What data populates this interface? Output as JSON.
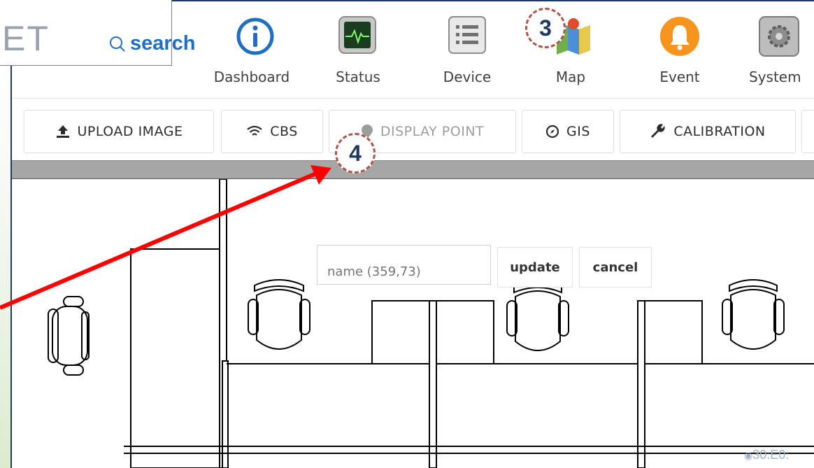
{
  "header": {
    "logo_text": "ET",
    "search_label": "search",
    "nav": [
      {
        "label": "Dashboard",
        "icon": "info-icon"
      },
      {
        "label": "Status",
        "icon": "monitor-pulse-icon"
      },
      {
        "label": "Device",
        "icon": "list-icon"
      },
      {
        "label": "Map",
        "icon": "map-icon"
      },
      {
        "label": "Event",
        "icon": "bell-icon"
      },
      {
        "label": "System",
        "icon": "system-gear-icon"
      }
    ]
  },
  "toolbar": {
    "upload_label": "UPLOAD IMAGE",
    "cbs_label": "CBS",
    "display_point_label": "DISPLAY POINT",
    "gis_label": "GIS",
    "calibration_label": "CALIBRATION"
  },
  "popup": {
    "name_placeholder": "name (359,73)",
    "update_label": "update",
    "cancel_label": "cancel"
  },
  "callouts": {
    "step3": "3",
    "step4": "4"
  },
  "status": {
    "mac_fragment": "30:E0:"
  },
  "colors": {
    "accent": "#1e6fc4",
    "frame": "#1f3864",
    "arrow": "#ff0000",
    "callout_border": "#b0544a",
    "event_orange": "#f7941d"
  }
}
